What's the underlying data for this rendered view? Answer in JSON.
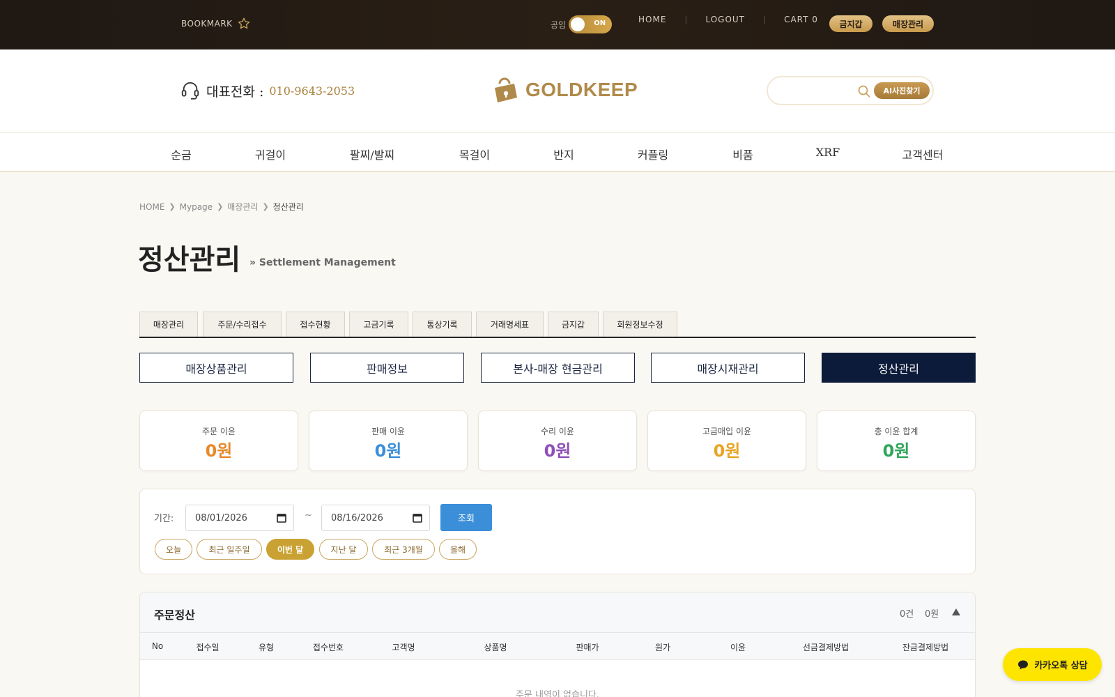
{
  "topbar": {
    "bookmark": "BOOKMARK",
    "toggle_label": "공임",
    "toggle_state": "ON",
    "nav": [
      "HOME",
      "LOGOUT",
      "CART 0"
    ],
    "pill_gold_price": "금지갑",
    "pill_store": "매장관리"
  },
  "header": {
    "phone_label": "대표전화 :",
    "phone_number": "010-9643-2053",
    "logo_text": "GOLDKEEP",
    "search_placeholder": "",
    "ai_button": "AI사진찾기"
  },
  "categories": [
    "순금",
    "귀걸이",
    "팔찌/발찌",
    "목걸이",
    "반지",
    "커플링",
    "비품",
    "XRF",
    "고객센터"
  ],
  "breadcrumb": [
    "HOME",
    "Mypage",
    "매장관리",
    "정산관리"
  ],
  "page": {
    "title": "정산관리",
    "subtitle": "» Settlement Management"
  },
  "tabs": [
    "매장관리",
    "주문/수리접수",
    "접수현황",
    "고금기록",
    "통상기록",
    "거래명세표",
    "금지갑",
    "회원정보수정"
  ],
  "sub_buttons": [
    "매장상품관리",
    "판매정보",
    "본사-매장 현금관리",
    "매장시재관리",
    "정산관리"
  ],
  "sub_active_index": 4,
  "stats": [
    {
      "label": "주문 이윤",
      "value": "0원",
      "color": "#e8892a"
    },
    {
      "label": "판매 이윤",
      "value": "0원",
      "color": "#3b8fd9"
    },
    {
      "label": "수리 이윤",
      "value": "0원",
      "color": "#8e4fb8"
    },
    {
      "label": "고금매입 이윤",
      "value": "0원",
      "color": "#e8a423"
    },
    {
      "label": "총 이윤 합계",
      "value": "0원",
      "color": "#2fa65a"
    }
  ],
  "filter": {
    "label": "기간:",
    "start_date": "08/01/2026",
    "end_date": "08/16/2026",
    "separator": "~",
    "query_button": "조회",
    "chips": [
      "오늘",
      "최근 일주일",
      "이번 달",
      "지난 달",
      "최근 3개월",
      "올해"
    ],
    "active_chip_index": 2
  },
  "orders": {
    "title": "주문정산",
    "count": "0건",
    "sum": "0원",
    "columns": [
      "No",
      "접수일",
      "유형",
      "접수번호",
      "고객명",
      "상품명",
      "판매가",
      "원가",
      "이윤",
      "선금결제방법",
      "잔금결제방법"
    ],
    "empty_message": "주문 내역이 없습니다."
  },
  "kakao": {
    "label": "카카오톡 상담"
  },
  "colors": {
    "accent_gold": "#c9a233",
    "navy": "#0d1b3a",
    "query_blue": "#3b8fd9",
    "kakao_yellow": "#fee500"
  }
}
